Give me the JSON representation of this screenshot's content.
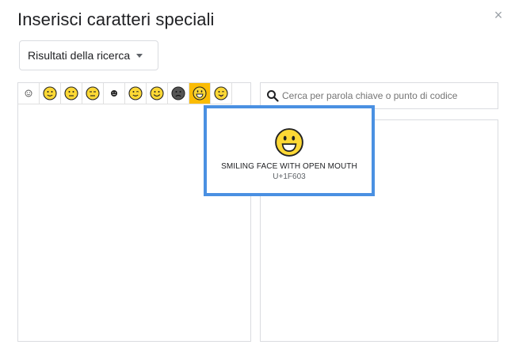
{
  "dialog": {
    "title": "Inserisci caratteri speciali",
    "close_label": "×",
    "close_icon": "close-icon"
  },
  "category": {
    "selected": "Risultati della ricerca",
    "icon": "chevron-down-icon"
  },
  "search": {
    "placeholder": "Cerca per parola chiave o punto di codice",
    "value": "",
    "icon": "search-icon"
  },
  "emoji_grid": {
    "items": [
      {
        "name": "small-smiley-icon",
        "selected": false
      },
      {
        "name": "slightly-smiling-face-icon",
        "selected": false
      },
      {
        "name": "neutral-face-icon",
        "selected": false
      },
      {
        "name": "expressionless-face-icon",
        "selected": false
      },
      {
        "name": "small-dark-face-icon",
        "selected": false
      },
      {
        "name": "winking-face-icon",
        "selected": false
      },
      {
        "name": "smiling-face-icon",
        "selected": false
      },
      {
        "name": "dark-frowning-face-icon",
        "selected": false
      },
      {
        "name": "smiling-face-with-open-mouth-icon",
        "selected": true
      },
      {
        "name": "face-with-stuck-out-tongue-icon",
        "selected": false
      }
    ]
  },
  "popup": {
    "name": "SMILING FACE WITH OPEN MOUTH",
    "code": "U+1F603",
    "icon": "smiling-face-with-open-mouth-icon"
  },
  "colors": {
    "accent": "#4a90e2",
    "selected_cell": "#fbbc04",
    "emoji_fill": "#fdd835",
    "border": "#dadce0"
  }
}
